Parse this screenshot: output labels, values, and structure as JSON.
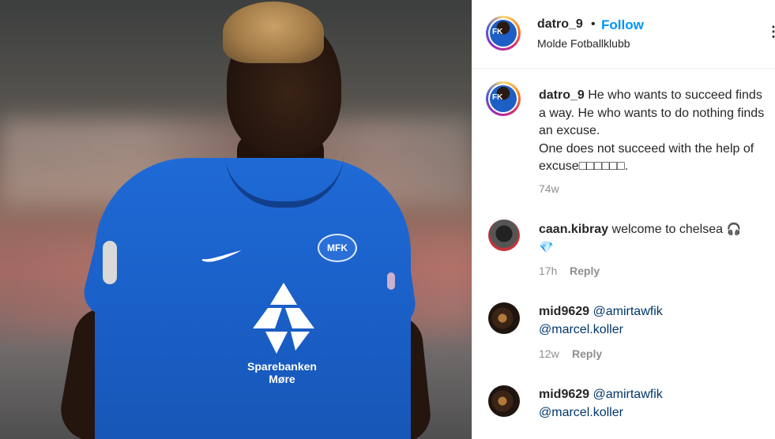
{
  "post": {
    "username": "datro_9",
    "follow_separator": "•",
    "follow_label": "Follow",
    "location": "Molde Fotballklubb",
    "more_icon": "more-options-icon",
    "sponsor": {
      "name_line1": "Sparebanken",
      "name_line2": "Møre"
    },
    "club_badge_text": "MFK"
  },
  "caption": {
    "username": "datro_9",
    "text": "He who wants to succeed finds a way. He who wants to do nothing finds an excuse.",
    "text2": "One does not succeed with the help of excuse",
    "symbols": "□□□□□□.",
    "time": "74w"
  },
  "comments": [
    {
      "username": "caan.kibray",
      "text": "welcome to chelsea",
      "emoji1": "🎧",
      "emoji2": "💎",
      "time": "17h",
      "reply_label": "Reply"
    },
    {
      "username": "mid9629",
      "mention1": "@amirtawfik",
      "mention2": "@marcel.koller",
      "time": "12w",
      "reply_label": "Reply"
    },
    {
      "username": "mid9629",
      "mention1": "@amirtawfik",
      "mention2": "@marcel.koller"
    }
  ],
  "colors": {
    "follow_blue": "#0095f6",
    "mention_blue": "#00376b",
    "muted_gray": "#8e8e8e",
    "shirt_blue": "#1f6ad6"
  }
}
